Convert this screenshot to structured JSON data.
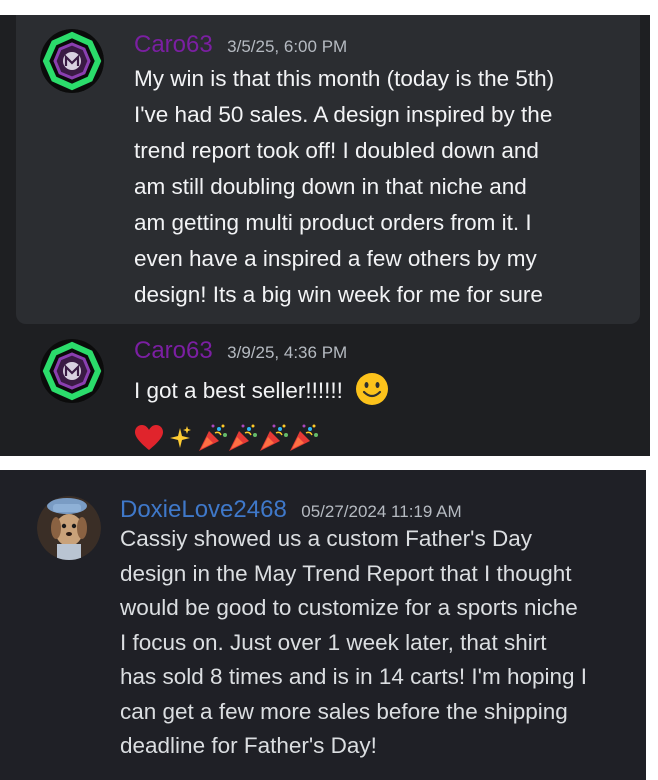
{
  "messages": [
    {
      "username": "Caro63",
      "timestamp": "3/5/25, 6:00 PM",
      "username_color": "#7b1fa2",
      "lines": [
        "My win is that this month (today is the 5th)",
        "I've had 50 sales. A design inspired by the",
        "trend report took off! I doubled down and",
        "am still doubling down in that niche and",
        "am getting multi product orders from it. I",
        "even have a inspired a few others by my",
        "design! Its a big win week for me for sure"
      ],
      "avatar_icon": "octagon-logo-icon"
    },
    {
      "username": "Caro63",
      "timestamp": "3/9/25, 4:36 PM",
      "username_color": "#7b1fa2",
      "text": "I got a best seller!!!!!!",
      "emojis": [
        "slightly-smiling-face-emoji",
        "red-heart-emoji",
        "sparkles-emoji",
        "party-popper-emoji",
        "party-popper-emoji",
        "party-popper-emoji",
        "party-popper-emoji"
      ],
      "avatar_icon": "octagon-logo-icon"
    },
    {
      "username": "DoxieLove2468",
      "timestamp": "05/27/2024 11:19 AM",
      "username_color": "#3f78c9",
      "lines": [
        "Cassiy showed us a custom Father's Day",
        "design in the May Trend Report that I thought",
        "would be good to customize for a sports niche",
        "I focus on. Just over 1 week later, that shirt",
        "has sold 8 times and is in 14 carts! I'm hoping I",
        "can get a few more sales before the shipping",
        "deadline for Father's Day!"
      ],
      "avatar_icon": "dog-photo-avatar"
    }
  ],
  "colors": {
    "panel_background": "#1e1f22",
    "highlight_background": "#2b2d31",
    "text": "#f2f3f5",
    "timestamp": "#b5bac1"
  }
}
